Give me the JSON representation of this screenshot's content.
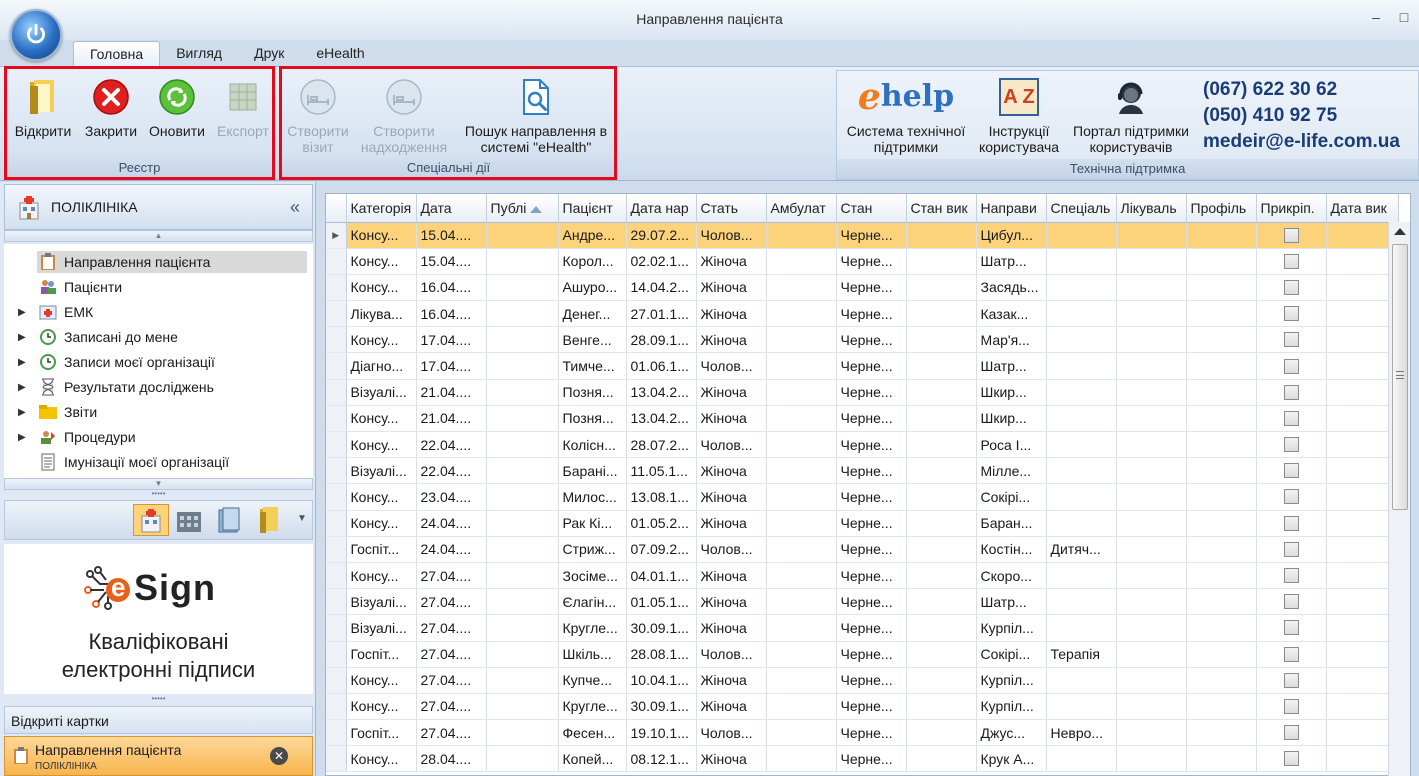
{
  "window": {
    "title": "Направлення пацієнта",
    "minimize": "–",
    "maximize": "□"
  },
  "tabs": [
    "Головна",
    "Вигляд",
    "Друк",
    "eHealth"
  ],
  "ribbon": {
    "registry": {
      "label": "Реєстр",
      "open": "Відкрити",
      "close": "Закрити",
      "refresh": "Оновити",
      "export": "Експорт"
    },
    "special": {
      "label": "Спеціальні дії",
      "create_visit_1": "Створити",
      "create_visit_2": "візит",
      "create_admission_1": "Створити",
      "create_admission_2": "надходження",
      "search_1": "Пошук направлення в",
      "search_2": "системі \"eHealth\""
    },
    "support": {
      "label": "Технічна підтримка",
      "ehelp_1": "Система технічної",
      "ehelp_2": "підтримки",
      "instr_1": "Інструкції",
      "instr_2": "користувача",
      "portal_1": "Портал підтримки",
      "portal_2": "користувачів",
      "phone1": "(067) 622 30 62",
      "phone2": "(050) 410 92 75",
      "email": "medeir@e-life.com.ua",
      "ehelp_logo_e": "e",
      "ehelp_logo_rest": "help",
      "az_logo": "A Z"
    }
  },
  "left_panel": {
    "header": "ПОЛІКЛІНІКА",
    "collapse": "«",
    "tree": [
      {
        "label": "Направлення пацієнта",
        "expandable": false,
        "selected": true
      },
      {
        "label": "Пацієнти",
        "expandable": false
      },
      {
        "label": "ЕМК",
        "expandable": true
      },
      {
        "label": "Записані до мене",
        "expandable": true
      },
      {
        "label": "Записи моєї організації",
        "expandable": true
      },
      {
        "label": "Результати досліджень",
        "expandable": true
      },
      {
        "label": "Звіти",
        "expandable": true
      },
      {
        "label": "Процедури",
        "expandable": true
      },
      {
        "label": "Імунізації моєї організації",
        "expandable": false
      }
    ],
    "esign": {
      "logo_e": "e",
      "logo_rest": "Sign",
      "slogan_1": "Кваліфіковані",
      "slogan_2": "електронні підписи"
    },
    "open_cards_label": "Відкриті картки",
    "open_card": {
      "title": "Направлення пацієнта",
      "subtitle": "ПОЛІКЛІНІКА"
    }
  },
  "grid": {
    "columns": [
      "Категорія",
      "Дата",
      "Публі",
      "Пацієнт",
      "Дата нар",
      "Стать",
      "Амбулат",
      "Стан",
      "Стан вик",
      "Направи",
      "Спеціаль",
      "Лікуваль",
      "Профіль",
      "Прикріп.",
      "Дата вик"
    ],
    "rows": [
      [
        "Консу...",
        "15.04....",
        "",
        "Андре...",
        "29.07.2...",
        "Чолов...",
        "",
        "Черне...",
        "",
        "Цибул...",
        "",
        "",
        "",
        "",
        ""
      ],
      [
        "Консу...",
        "15.04....",
        "",
        "Корол...",
        "02.02.1...",
        "Жіноча",
        "",
        "Черне...",
        "",
        "Шатр...",
        "",
        "",
        "",
        "",
        ""
      ],
      [
        "Консу...",
        "16.04....",
        "",
        "Ашуро...",
        "14.04.2...",
        "Жіноча",
        "",
        "Черне...",
        "",
        "Засядь...",
        "",
        "",
        "",
        "",
        ""
      ],
      [
        "Лікува...",
        "16.04....",
        "",
        "Денег...",
        "27.01.1...",
        "Жіноча",
        "",
        "Черне...",
        "",
        "Казак...",
        "",
        "",
        "",
        "",
        ""
      ],
      [
        "Консу...",
        "17.04....",
        "",
        "Венге...",
        "28.09.1...",
        "Жіноча",
        "",
        "Черне...",
        "",
        "Мар'я...",
        "",
        "",
        "",
        "",
        ""
      ],
      [
        "Діагно...",
        "17.04....",
        "",
        "Тимче...",
        "01.06.1...",
        "Чолов...",
        "",
        "Черне...",
        "",
        "Шатр...",
        "",
        "",
        "",
        "",
        ""
      ],
      [
        "Візуалі...",
        "21.04....",
        "",
        "Позня...",
        "13.04.2...",
        "Жіноча",
        "",
        "Черне...",
        "",
        "Шкир...",
        "",
        "",
        "",
        "",
        ""
      ],
      [
        "Консу...",
        "21.04....",
        "",
        "Позня...",
        "13.04.2...",
        "Жіноча",
        "",
        "Черне...",
        "",
        "Шкир...",
        "",
        "",
        "",
        "",
        ""
      ],
      [
        "Консу...",
        "22.04....",
        "",
        "Колісн...",
        "28.07.2...",
        "Чолов...",
        "",
        "Черне...",
        "",
        "Роса І...",
        "",
        "",
        "",
        "",
        ""
      ],
      [
        "Візуалі...",
        "22.04....",
        "",
        "Барані...",
        "11.05.1...",
        "Жіноча",
        "",
        "Черне...",
        "",
        "Мілле...",
        "",
        "",
        "",
        "",
        ""
      ],
      [
        "Консу...",
        "23.04....",
        "",
        "Милос...",
        "13.08.1...",
        "Жіноча",
        "",
        "Черне...",
        "",
        "Сокірі...",
        "",
        "",
        "",
        "",
        ""
      ],
      [
        "Консу...",
        "24.04....",
        "",
        "Рак Кі...",
        "01.05.2...",
        "Жіноча",
        "",
        "Черне...",
        "",
        "Баран...",
        "",
        "",
        "",
        "",
        ""
      ],
      [
        "Госпіт...",
        "24.04....",
        "",
        "Стриж...",
        "07.09.2...",
        "Чолов...",
        "",
        "Черне...",
        "",
        "Костін...",
        "Дитяч...",
        "",
        "",
        "",
        ""
      ],
      [
        "Консу...",
        "27.04....",
        "",
        "Зосіме...",
        "04.01.1...",
        "Жіноча",
        "",
        "Черне...",
        "",
        "Скоро...",
        "",
        "",
        "",
        "",
        ""
      ],
      [
        "Візуалі...",
        "27.04....",
        "",
        "Єлагін...",
        "01.05.1...",
        "Жіноча",
        "",
        "Черне...",
        "",
        "Шатр...",
        "",
        "",
        "",
        "",
        ""
      ],
      [
        "Візуалі...",
        "27.04....",
        "",
        "Кругле...",
        "30.09.1...",
        "Жіноча",
        "",
        "Черне...",
        "",
        "Курпіл...",
        "",
        "",
        "",
        "",
        ""
      ],
      [
        "Госпіт...",
        "27.04....",
        "",
        "Шкіль...",
        "28.08.1...",
        "Чолов...",
        "",
        "Черне...",
        "",
        "Сокірі...",
        "Терапія",
        "",
        "",
        "",
        ""
      ],
      [
        "Консу...",
        "27.04....",
        "",
        "Купче...",
        "10.04.1...",
        "Жіноча",
        "",
        "Черне...",
        "",
        "Курпіл...",
        "",
        "",
        "",
        "",
        ""
      ],
      [
        "Консу...",
        "27.04....",
        "",
        "Кругле...",
        "30.09.1...",
        "Жіноча",
        "",
        "Черне...",
        "",
        "Курпіл...",
        "",
        "",
        "",
        "",
        ""
      ],
      [
        "Госпіт...",
        "27.04....",
        "",
        "Фесен...",
        "19.10.1...",
        "Чолов...",
        "",
        "Черне...",
        "",
        "Джус...",
        "Невро...",
        "",
        "",
        "",
        ""
      ],
      [
        "Консу...",
        "28.04....",
        "",
        "Копей...",
        "08.12.1...",
        "Жіноча",
        "",
        "Черне...",
        "",
        "Крук А...",
        "",
        "",
        "",
        "",
        ""
      ]
    ],
    "selected_row": 0
  },
  "colors": {
    "accent_orange": "#f7b54d",
    "highlight_row": "#fcd37b",
    "red_outline": "#e5091d",
    "brand_blue": "#1a3d78"
  }
}
